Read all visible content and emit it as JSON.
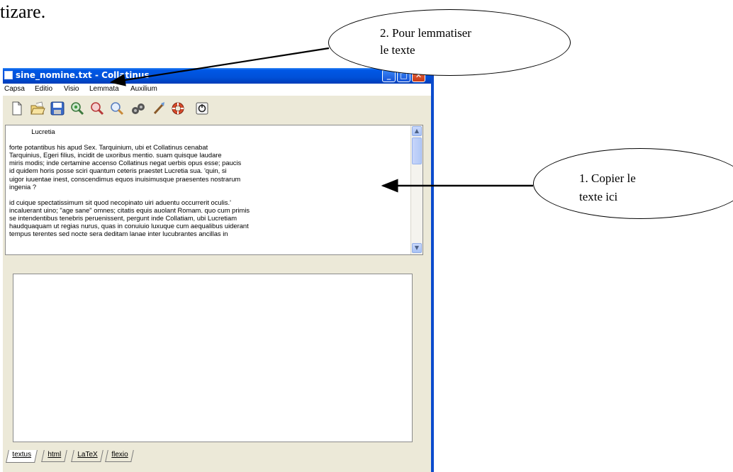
{
  "top_text": "tizare.",
  "window": {
    "title": "sine_nomine.txt - Collatinus",
    "menu": [
      "Capsa",
      "Editio",
      "Visio",
      "Lemmata",
      "Auxilium"
    ]
  },
  "toolbar_icons": [
    "new-file-icon",
    "open-folder-icon",
    "save-icon",
    "lemmatize-all-icon",
    "lemmatize-icon",
    "search-icon",
    "binoculars-icon",
    "brush-icon",
    "lifebuoy-icon",
    "power-icon"
  ],
  "text_content": "            Lucretia\n\nforte potantibus his apud Sex. Tarquinium, ubi et Collatinus cenabat\nTarquinius, Egeri filius, incidit de uxoribus mentio. suam quisque laudare\nmiris modis; inde certamine accenso Collatinus negat uerbis opus esse; paucis\nid quidem horis posse sciri quantum ceteris praestet Lucretia sua. 'quin, si\nuigor iuuentae inest, conscendimus equos inuisimusque praesentes nostrarum\ningenia ?\n\nid cuique spectatissimum sit quod necopinato uiri aduentu occurrerit oculis.'\nincaluerant uino; \"age sane\" omnes; citatis equis auolant Romam. quo cum primis\nse intendentibus tenebris peruenissent, pergunt inde Collatiam, ubi Lucretiam\nhaudquaquam ut regias nurus, quas in conuiuio luxuque cum aequalibus uiderant\ntempus terentes sed nocte sera deditam lanae inter lucubrantes ancillas in",
  "tabs": [
    "textus",
    "html",
    "LaTeX",
    "flexio"
  ],
  "annotations": {
    "lemmatize": {
      "line1": "2. Pour lemmatiser",
      "line2": "le texte"
    },
    "copy": {
      "line1": "1. Copier le",
      "line2": "texte ici"
    }
  },
  "colors": {
    "titlebar": "#0054e3",
    "window_bg": "#ece9d8",
    "close_button": "#d8532e"
  }
}
